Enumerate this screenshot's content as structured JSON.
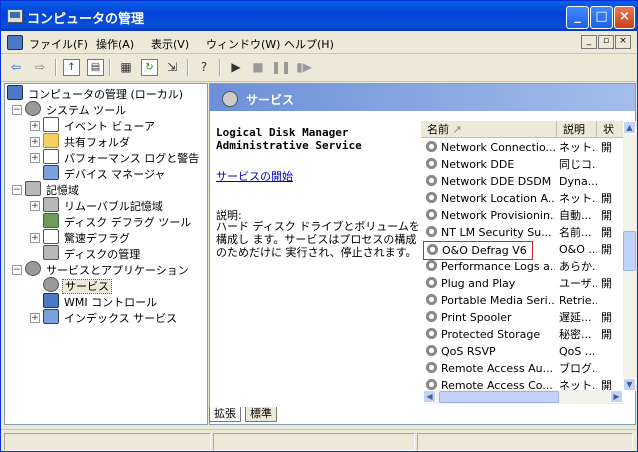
{
  "window": {
    "title": "コンピュータの管理"
  },
  "menu": [
    "ファイル(F)",
    "操作(A)",
    "表示(V)",
    "ウィンドウ(W)",
    "ヘルプ(H)"
  ],
  "tree": [
    {
      "label": "コンピュータの管理 (ローカル)",
      "icon": "computer-icon"
    },
    {
      "label": "システム ツール",
      "icon": "tools-icon"
    },
    {
      "label": "イベント ビューア",
      "icon": "event-viewer-icon"
    },
    {
      "label": "共有フォルダ",
      "icon": "shared-folder-icon"
    },
    {
      "label": "パフォーマンス ログと警告",
      "icon": "performance-icon"
    },
    {
      "label": "デバイス マネージャ",
      "icon": "device-manager-icon"
    },
    {
      "label": "記憶域",
      "icon": "storage-icon"
    },
    {
      "label": "リムーバブル記憶域",
      "icon": "removable-storage-icon"
    },
    {
      "label": "ディスク デフラグ ツール",
      "icon": "defrag-tool-icon"
    },
    {
      "label": "驚速デフラグ",
      "icon": "fast-defrag-icon"
    },
    {
      "label": "ディスクの管理",
      "icon": "disk-management-icon"
    },
    {
      "label": "サービスとアプリケーション",
      "icon": "services-apps-icon"
    },
    {
      "label": "サービス",
      "icon": "services-gear-icon"
    },
    {
      "label": "WMI コントロール",
      "icon": "wmi-icon"
    },
    {
      "label": "インデックス サービス",
      "icon": "index-service-icon"
    }
  ],
  "panel": {
    "title": "サービス",
    "service_name": "Logical Disk Manager Administrative Service",
    "start_link": "サービスの開始",
    "desc_label": "説明:",
    "desc_text": "ハード ディスク ドライブとボリュームを構成し ます。サービスはプロセスの構成のためだけに 実行され、停止されます。"
  },
  "list": {
    "columns": [
      "名前",
      "説明",
      "状"
    ],
    "rows": [
      [
        "Network Connectio...",
        "ネット...",
        "開"
      ],
      [
        "Network DDE",
        "同じコ...",
        ""
      ],
      [
        "Network DDE DSDM",
        "Dyna...",
        ""
      ],
      [
        "Network Location A...",
        "ネット...",
        "開"
      ],
      [
        "Network Provisionin...",
        "自動...",
        "開"
      ],
      [
        "NT LM Security Su...",
        "名前...",
        "開"
      ],
      [
        "O&O Defrag V6",
        "O&O ...",
        "開"
      ],
      [
        "Performance Logs a...",
        "あらか...",
        ""
      ],
      [
        "Plug and Play",
        "ユーザ...",
        "開"
      ],
      [
        "Portable Media Seri...",
        "Retrie...",
        ""
      ],
      [
        "Print Spooler",
        "遅延...",
        "開"
      ],
      [
        "Protected Storage",
        "秘密...",
        "開"
      ],
      [
        "QoS RSVP",
        "QoS ...",
        ""
      ],
      [
        "Remote Access Au...",
        "ブログ...",
        ""
      ],
      [
        "Remote Access Co...",
        "ネット...",
        "開"
      ]
    ]
  },
  "tabs": [
    "拡張",
    "標準"
  ]
}
